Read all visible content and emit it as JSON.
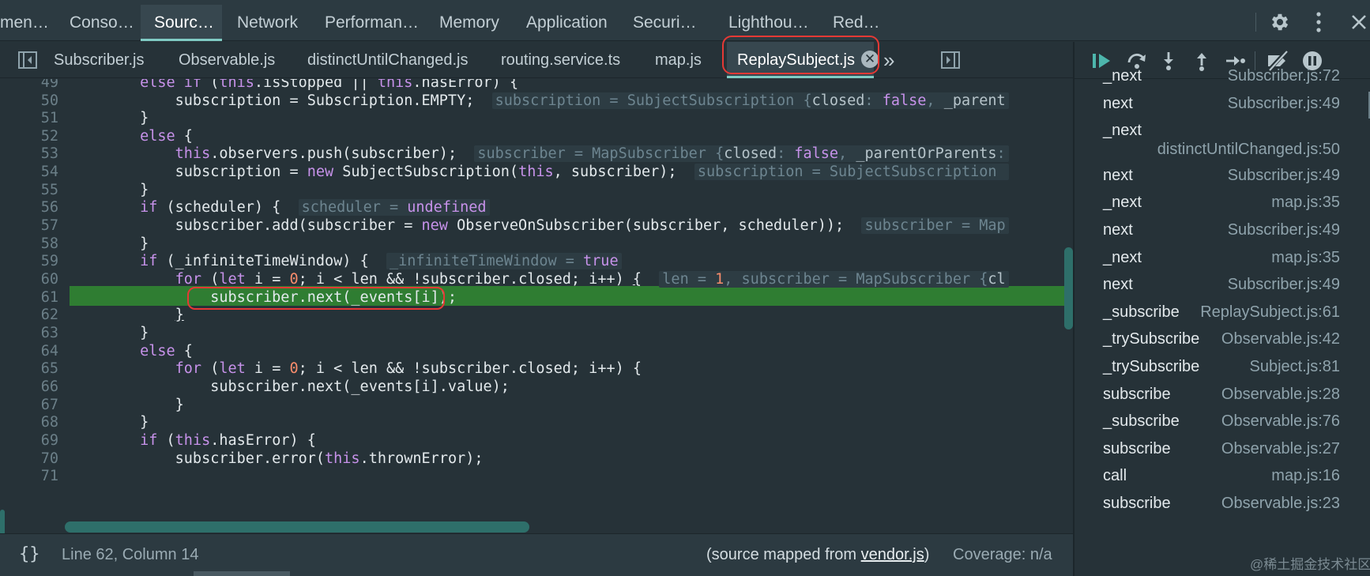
{
  "panel_tabs": [
    "men…",
    "Conso…",
    "Sourc…",
    "Network",
    "Performan…",
    "Memory",
    "Application",
    "Securi…",
    "Lighthou…",
    "Red…"
  ],
  "active_panel_tab": "Sourc…",
  "file_tabs": [
    "Subscriber.js",
    "Observable.js",
    "distinctUntilChanged.js",
    "routing.service.ts",
    "map.js",
    "ReplaySubject.js"
  ],
  "active_file_tab": "ReplaySubject.js",
  "file_tab_close": "✕",
  "overflow_glyph": "»",
  "code": {
    "line_numbers": [
      "49",
      "50",
      "51",
      "52",
      "53",
      "54",
      "55",
      "56",
      "57",
      "58",
      "59",
      "60",
      "61",
      "62",
      "63",
      "64",
      "65",
      "66",
      "67",
      "68",
      "69",
      "70",
      "71"
    ],
    "execution_line": "61"
  },
  "status": {
    "braces": "{}",
    "position": "Line 62, Column 14",
    "mapped_prefix": "(source mapped from ",
    "mapped_link": "vendor.js",
    "mapped_suffix": ")",
    "coverage": "Coverage: n/a"
  },
  "call_stack": [
    {
      "name": "_next",
      "location": "Subscriber.js:72"
    },
    {
      "name": "next",
      "location": "Subscriber.js:49"
    },
    {
      "name": "_next",
      "location": "distinctUntilChanged.js:50"
    },
    {
      "name": "next",
      "location": "Subscriber.js:49"
    },
    {
      "name": "_next",
      "location": "map.js:35"
    },
    {
      "name": "next",
      "location": "Subscriber.js:49"
    },
    {
      "name": "_next",
      "location": "map.js:35"
    },
    {
      "name": "next",
      "location": "Subscriber.js:49"
    },
    {
      "name": "_subscribe",
      "location": "ReplaySubject.js:61"
    },
    {
      "name": "_trySubscribe",
      "location": "Observable.js:42"
    },
    {
      "name": "_trySubscribe",
      "location": "Subject.js:81"
    },
    {
      "name": "subscribe",
      "location": "Observable.js:28"
    },
    {
      "name": "_subscribe",
      "location": "Observable.js:76"
    },
    {
      "name": "subscribe",
      "location": "Observable.js:27"
    },
    {
      "name": "call",
      "location": "map.js:16"
    },
    {
      "name": "subscribe",
      "location": "Observable.js:23"
    }
  ],
  "watermark": "@稀土掘金技术社区",
  "colors": {
    "accent": "#80cbc4",
    "exec_line": "#2f7d32",
    "highlight_box": "#e53935"
  }
}
